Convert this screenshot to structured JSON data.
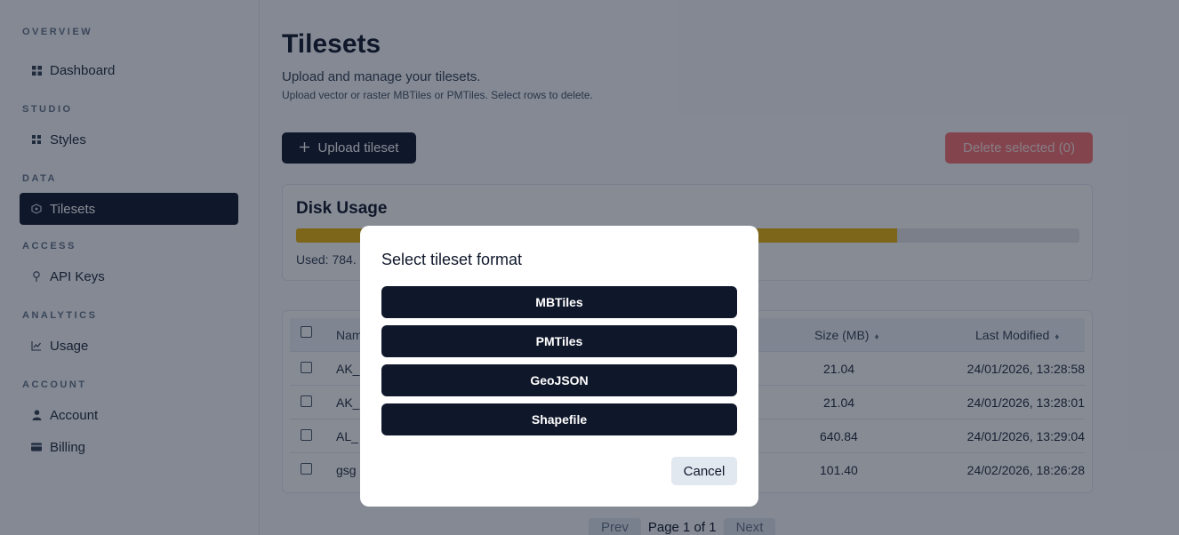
{
  "sidebar": {
    "sections": [
      {
        "label": "OVERVIEW",
        "items": [
          {
            "label": "Dashboard",
            "icon": "grid-icon"
          }
        ]
      },
      {
        "label": "STUDIO",
        "items": [
          {
            "label": "Styles",
            "icon": "dots-grid-icon"
          }
        ]
      },
      {
        "label": "DATA",
        "items": [
          {
            "label": "Tilesets",
            "icon": "tileset-icon",
            "active": true
          }
        ]
      },
      {
        "label": "ACCESS",
        "items": [
          {
            "label": "API Keys",
            "icon": "key-icon"
          }
        ]
      },
      {
        "label": "ANALYTICS",
        "items": [
          {
            "label": "Usage",
            "icon": "chart-icon"
          }
        ]
      },
      {
        "label": "ACCOUNT",
        "items": [
          {
            "label": "Account",
            "icon": "user-icon"
          },
          {
            "label": "Billing",
            "icon": "card-icon"
          }
        ]
      }
    ]
  },
  "main": {
    "title": "Tilesets",
    "subtitle": "Upload and manage your tilesets.",
    "help": "Upload vector or raster MBTiles or PMTiles. Select rows to delete.",
    "upload_label": "Upload tileset",
    "delete_label": "Delete selected (0)",
    "disk": {
      "title": "Disk Usage",
      "used_text": "Used: 784.",
      "fill_fraction": 0.767
    },
    "table": {
      "columns": {
        "name": "Nam",
        "size": "Size (MB)",
        "modified": "Last Modified"
      },
      "rows": [
        {
          "name": "AK_",
          "size": "21.04",
          "modified": "24/01/2026, 13:28:58"
        },
        {
          "name": "AK_",
          "size": "21.04",
          "modified": "24/01/2026, 13:28:01"
        },
        {
          "name": "AL_",
          "size": "640.84",
          "modified": "24/01/2026, 13:29:04"
        },
        {
          "name": "gsg",
          "size": "101.40",
          "modified": "24/02/2026, 18:26:28"
        }
      ]
    },
    "pager": {
      "prev": "Prev",
      "page": "Page 1 of 1",
      "next": "Next"
    }
  },
  "modal": {
    "title": "Select tileset format",
    "options": [
      "MBTiles",
      "PMTiles",
      "GeoJSON",
      "Shapefile"
    ],
    "cancel": "Cancel"
  },
  "colors": {
    "primary": "#0f172a",
    "danger": "#f87171",
    "usage_bar": "#eab308"
  }
}
